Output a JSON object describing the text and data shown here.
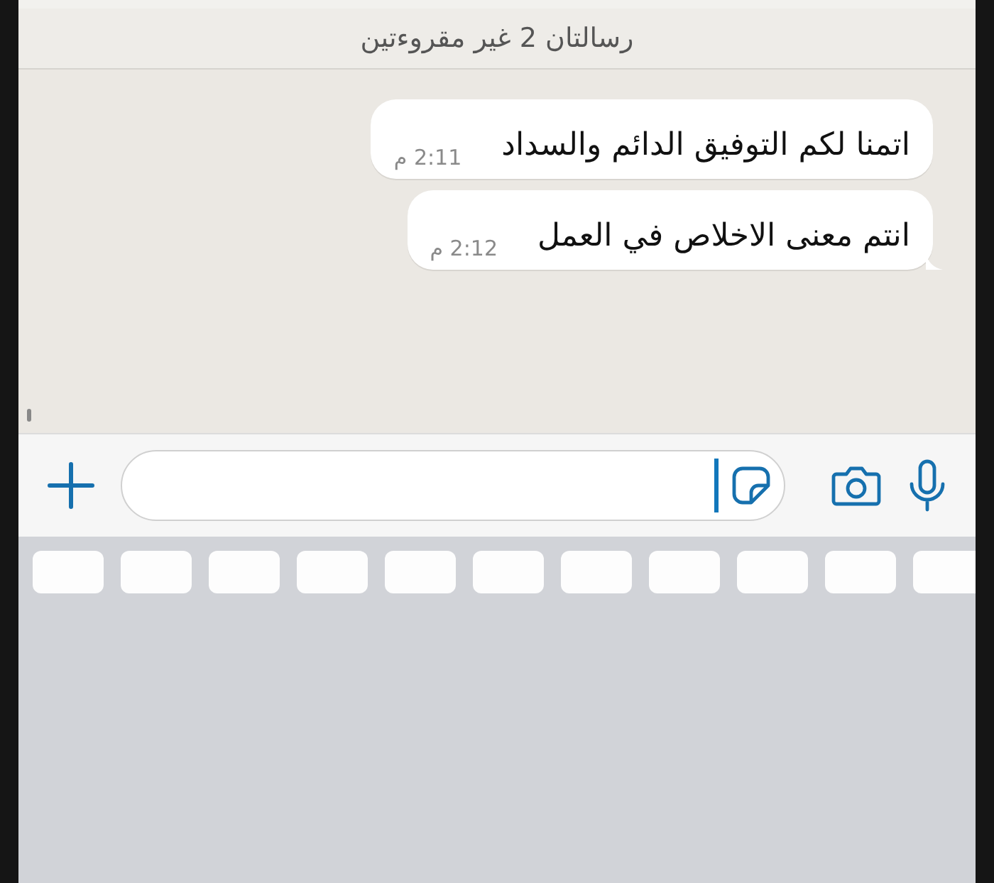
{
  "unread_banner": "رسالتان 2 غير مقروءتين",
  "messages": [
    {
      "text": "اتمنا لكم التوفيق الدائم والسداد",
      "time": "2:11 م",
      "tail": false
    },
    {
      "text": "انتم معنى الاخلاص في العمل",
      "time": "2:12 م",
      "tail": true
    }
  ],
  "composer": {
    "focused": true
  }
}
